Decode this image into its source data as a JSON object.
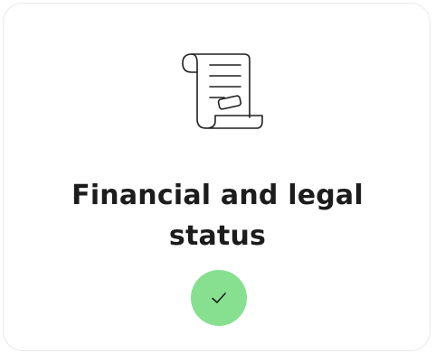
{
  "card": {
    "title_line1": "Financial and legal",
    "title_line2": "status",
    "icon": "document-scroll-icon",
    "status": {
      "icon": "checkmark-icon",
      "color": "#86e08f"
    }
  }
}
